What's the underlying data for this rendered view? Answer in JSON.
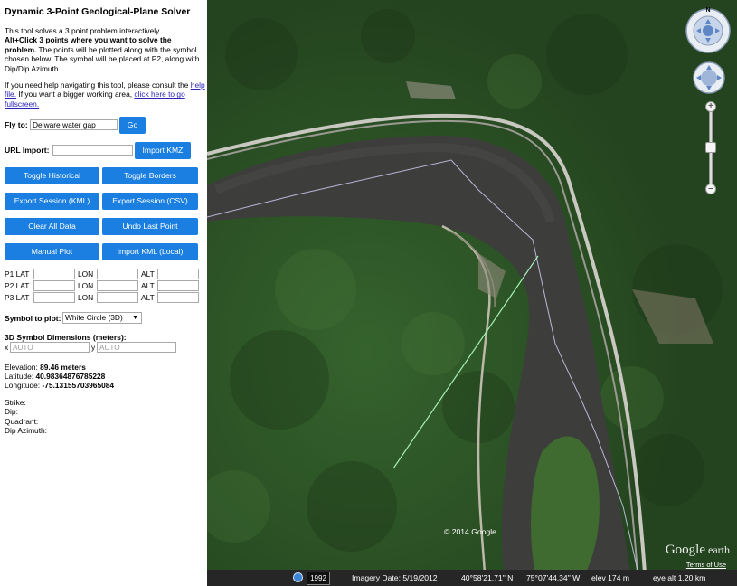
{
  "panel": {
    "title": "Dynamic 3-Point Geological-Plane Solver",
    "intro_1": "This tool solves a 3 point problem interactively.",
    "intro_bold": "Alt+Click 3 points where you want to solve the problem.",
    "intro_2": " The points will be plotted along with the symbol chosen below. The symbol will be placed at P2, along with Dip/Dip Azimuth.",
    "help_1": "If you need help navigating this tool, please consult the ",
    "help_link": "help file.",
    "help_2": " If you want a bigger working area, ",
    "fullscreen_link": "click here to go fullscreen."
  },
  "fly": {
    "label": "Fly to:",
    "value": "Delware water gap",
    "button": "Go"
  },
  "url_import": {
    "label": "URL Import:",
    "value": "",
    "button": "Import KMZ"
  },
  "buttons": {
    "toggle_historical": "Toggle Historical",
    "toggle_borders": "Toggle Borders",
    "export_kml": "Export Session (KML)",
    "export_csv": "Export Session (CSV)",
    "clear_all": "Clear All Data",
    "undo_last": "Undo Last Point",
    "manual_plot": "Manual Plot",
    "import_kml": "Import KML (Local)"
  },
  "points": {
    "lat": "LAT",
    "lon": "LON",
    "alt": "ALT",
    "rows": [
      "P1",
      "P2",
      "P3"
    ]
  },
  "symbol": {
    "label": "Symbol to plot:",
    "selected": "White Circle (3D)"
  },
  "dimensions": {
    "label": "3D Symbol Dimensions (meters):",
    "x_label": "x",
    "y_label": "y",
    "placeholder": "AUTO"
  },
  "readout": {
    "elevation_label": "Elevation: ",
    "elevation_value": "89.46 meters",
    "latitude_label": "Latitude: ",
    "latitude_value": "40.98364876785228",
    "longitude_label": "Longitude: ",
    "longitude_value": "-75.13155703965084"
  },
  "results": {
    "strike": "Strike:",
    "dip": "Dip:",
    "quadrant": "Quadrant:",
    "dip_azimuth": "Dip Azimuth:"
  },
  "map": {
    "copyright": "© 2014 Google",
    "logo_main": "Google",
    "logo_small": " earth",
    "terms": "Terms of Use",
    "compass_n": "N",
    "status": {
      "year": "1992",
      "imagery_date": "Imagery Date: 5/19/2012",
      "lat": "40°58'21.71\" N",
      "lon": "75°07'44.34\" W",
      "elev": "elev   174 m",
      "eye_alt": "eye alt   1.20 km"
    },
    "colors": {
      "water": "#3b3b3b",
      "forest": "#2f5a2a",
      "button_blue": "#1a7fe0"
    }
  }
}
